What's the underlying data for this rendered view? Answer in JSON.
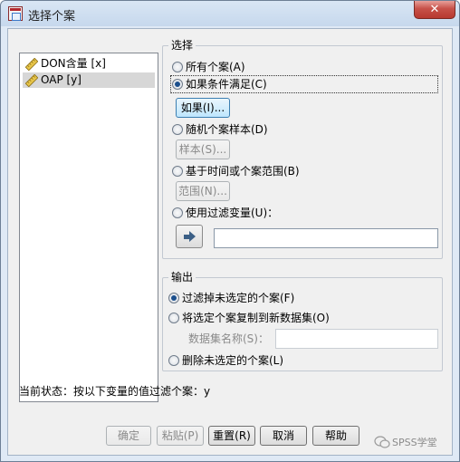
{
  "window": {
    "title": "选择个案",
    "close_label": "✕"
  },
  "variables": [
    {
      "label": "DON含量 [x]",
      "selected": false
    },
    {
      "label": "OAP [y]",
      "selected": true
    }
  ],
  "select_group": {
    "title": "选择",
    "options": {
      "all_cases": "所有个案(A)",
      "if_condition": "如果条件满足(C)",
      "random_sample": "随机个案样本(D)",
      "time_range": "基于时间或个案范围(B)",
      "filter_variable": "使用过滤变量(U)："
    },
    "selected": "if_condition",
    "if_button": "如果(I)...",
    "sample_button": "样本(S)...",
    "range_button": "范围(N)...",
    "filter_value": ""
  },
  "output_group": {
    "title": "输出",
    "options": {
      "filter_out": "过滤掉未选定的个案(F)",
      "copy_new": "将选定个案复制到新数据集(O)",
      "delete": "删除未选定的个案(L)"
    },
    "selected": "filter_out",
    "dataset_name_label": "数据集名称(S)：",
    "dataset_name_value": ""
  },
  "status": {
    "text": "当前状态：按以下变量的值过滤个案：y"
  },
  "buttons": {
    "ok": "确定",
    "paste": "粘贴(P)",
    "reset": "重置(R)",
    "cancel": "取消",
    "help": "帮助"
  },
  "watermark": "SPSS学堂"
}
